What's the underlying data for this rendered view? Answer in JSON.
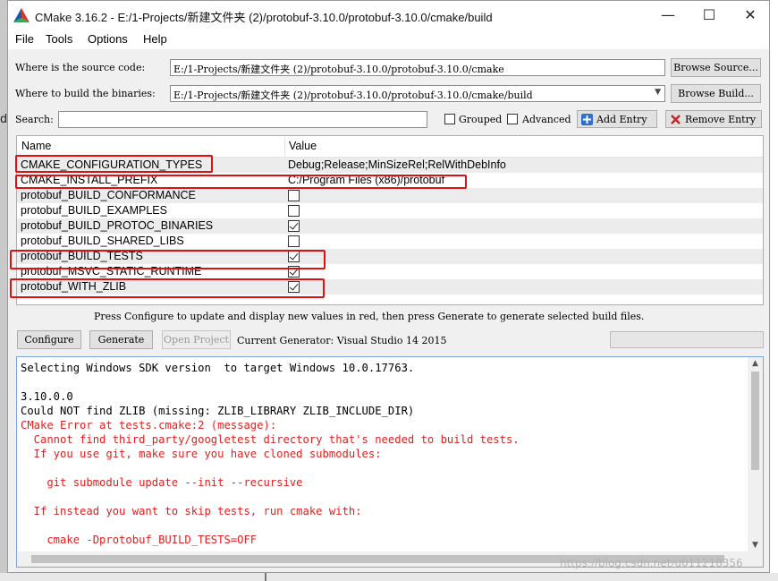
{
  "window": {
    "title": "CMake 3.16.2 - E:/1-Projects/新建文件夹 (2)/protobuf-3.10.0/protobuf-3.10.0/cmake/build",
    "minimize": "—",
    "maximize": "☐",
    "close": "✕"
  },
  "background_glyph": "d",
  "menu": [
    "File",
    "Tools",
    "Options",
    "Help"
  ],
  "source": {
    "label": "Where is the source code:",
    "value": "E:/1-Projects/新建文件夹 (2)/protobuf-3.10.0/protobuf-3.10.0/cmake",
    "button": "Browse Source..."
  },
  "binaries": {
    "label": "Where to build the binaries:",
    "value": "E:/1-Projects/新建文件夹 (2)/protobuf-3.10.0/protobuf-3.10.0/cmake/build",
    "button": "Browse Build..."
  },
  "search": {
    "label": "Search:",
    "value": "",
    "grouped_label": "Grouped",
    "advanced_label": "Advanced",
    "add_entry": "Add Entry",
    "remove_entry": "Remove Entry"
  },
  "table": {
    "col_name": "Name",
    "col_value": "Value",
    "rows": [
      {
        "name": "CMAKE_CONFIGURATION_TYPES",
        "value": "Debug;Release;MinSizeRel;RelWithDebInfo"
      },
      {
        "name": "CMAKE_INSTALL_PREFIX",
        "value": "C:/Program Files (x86)/protobuf"
      },
      {
        "name": "protobuf_BUILD_CONFORMANCE",
        "checked": false
      },
      {
        "name": "protobuf_BUILD_EXAMPLES",
        "checked": false
      },
      {
        "name": "protobuf_BUILD_PROTOC_BINARIES",
        "checked": true
      },
      {
        "name": "protobuf_BUILD_SHARED_LIBS",
        "checked": false
      },
      {
        "name": "protobuf_BUILD_TESTS",
        "checked": true
      },
      {
        "name": "protobuf_MSVC_STATIC_RUNTIME",
        "checked": true
      },
      {
        "name": "protobuf_WITH_ZLIB",
        "checked": true
      }
    ]
  },
  "hint": "Press Configure to update and display new values in red,  then press Generate to generate selected build files.",
  "actions": {
    "configure": "Configure",
    "generate": "Generate",
    "open_project": "Open Project",
    "generator": "Current Generator: Visual Studio 14 2015"
  },
  "output": [
    {
      "text": "Selecting Windows SDK version  to target Windows 10.0.17763.",
      "error": false
    },
    {
      "text": "",
      "error": false
    },
    {
      "text": "3.10.0.0",
      "error": false
    },
    {
      "text": "Could NOT find ZLIB (missing: ZLIB_LIBRARY ZLIB_INCLUDE_DIR)",
      "error": false
    },
    {
      "text": "CMake Error at tests.cmake:2 (message):",
      "error": true
    },
    {
      "text": "  Cannot find third_party/googletest directory that's needed to build tests.",
      "error": true
    },
    {
      "text": "  If you use git, make sure you have cloned submodules:",
      "error": true
    },
    {
      "text": "",
      "error": true
    },
    {
      "text": "    git submodule update --init --recursive",
      "error": true
    },
    {
      "text": "",
      "error": true
    },
    {
      "text": "  If instead you want to skip tests, run cmake with:",
      "error": true
    },
    {
      "text": "",
      "error": true
    },
    {
      "text": "    cmake -Dprotobuf_BUILD_TESTS=OFF",
      "error": true
    }
  ],
  "watermark": "https://blog.csdn.net/u011218356",
  "colors": {
    "error_text": "#e02020",
    "highlight_box": "#e01010"
  }
}
